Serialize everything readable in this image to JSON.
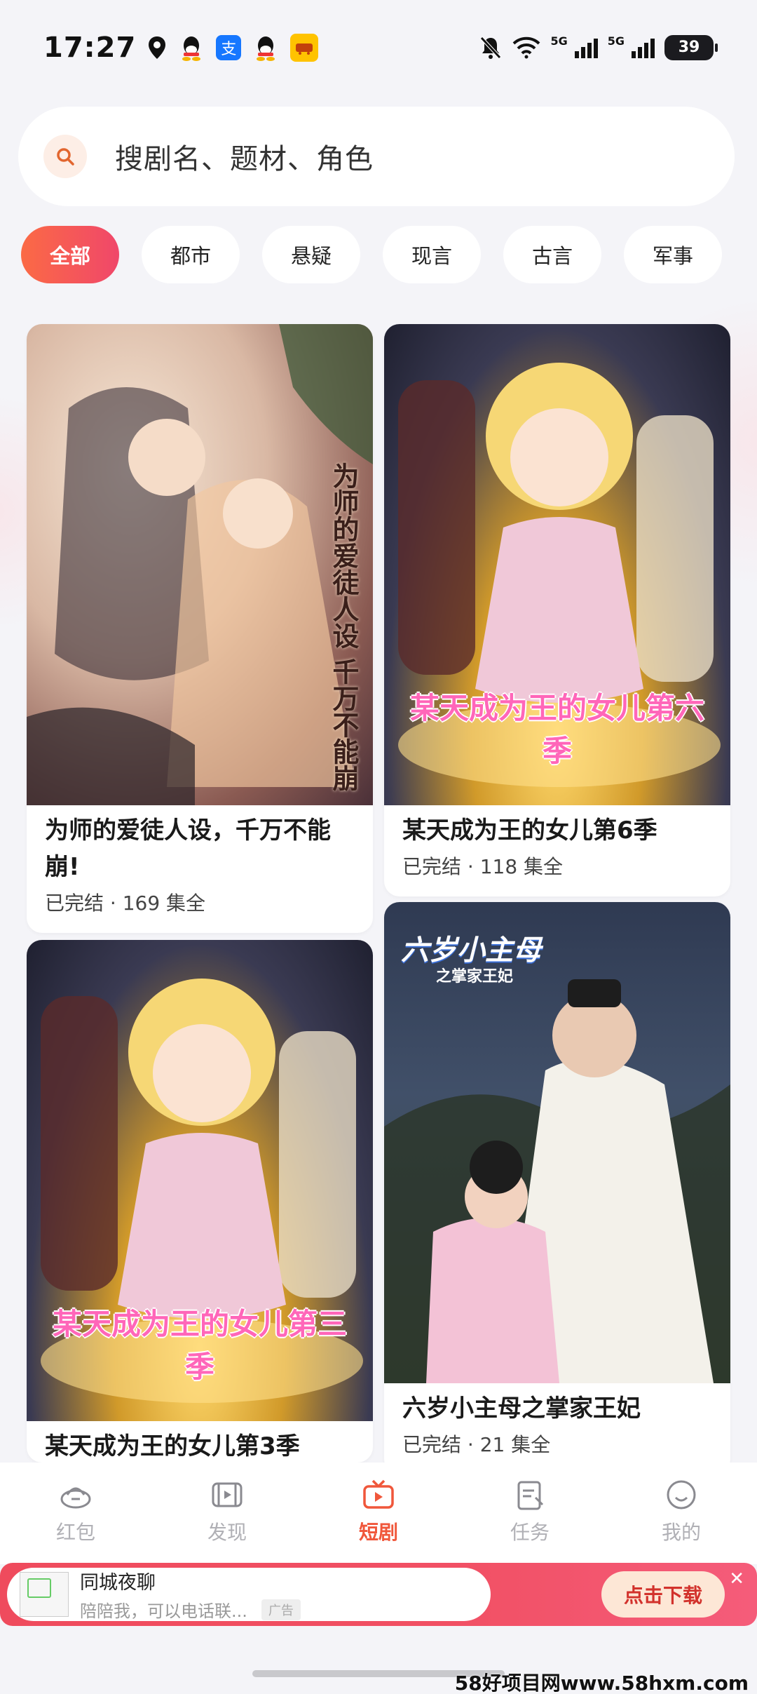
{
  "status_bar": {
    "time": "17:27",
    "battery": "39",
    "net1": "5G",
    "net2": "5G",
    "left_icons": [
      "location-icon",
      "qq-icon",
      "alipay-icon",
      "qq-icon",
      "taobao-icon"
    ],
    "alipay_glyph": "支"
  },
  "search": {
    "placeholder": "搜剧名、题材、角色"
  },
  "filters": [
    "全部",
    "都市",
    "悬疑",
    "现言",
    "古言",
    "军事"
  ],
  "cards": [
    {
      "title": "为师的爱徒人设，千万不能崩!",
      "meta": "已完结 · 169 集全",
      "poster_caption": "为师的爱徒人设 千万不能崩"
    },
    {
      "title": "某天成为王的女儿第6季",
      "meta": "已完结 · 118 集全",
      "poster_caption": "某天成为王的女儿第六季"
    },
    {
      "title": "某天成为王的女儿第3季",
      "meta": "",
      "poster_caption": "某天成为王的女儿第三季"
    },
    {
      "title": "六岁小主母之掌家王妃",
      "meta": "已完结 · 21 集全",
      "poster_caption": "六岁小主母",
      "poster_subcaption": "之掌家王妃"
    }
  ],
  "bottom_nav": [
    {
      "label": "红包",
      "icon": "red-packet-icon"
    },
    {
      "label": "发现",
      "icon": "discover-icon"
    },
    {
      "label": "短剧",
      "icon": "short-drama-icon",
      "active": true
    },
    {
      "label": "任务",
      "icon": "task-icon"
    },
    {
      "label": "我的",
      "icon": "profile-icon"
    }
  ],
  "ad": {
    "title": "同城夜聊",
    "subtitle": "陪陪我，可以电话联...",
    "tag": "广告",
    "button": "点击下载",
    "close": "✕"
  },
  "watermark": "58好项目网www.58hxm.com",
  "colors": {
    "accent": "#f0573b",
    "chip_gradient_start": "#fb6a45",
    "chip_gradient_end": "#f0476a"
  }
}
